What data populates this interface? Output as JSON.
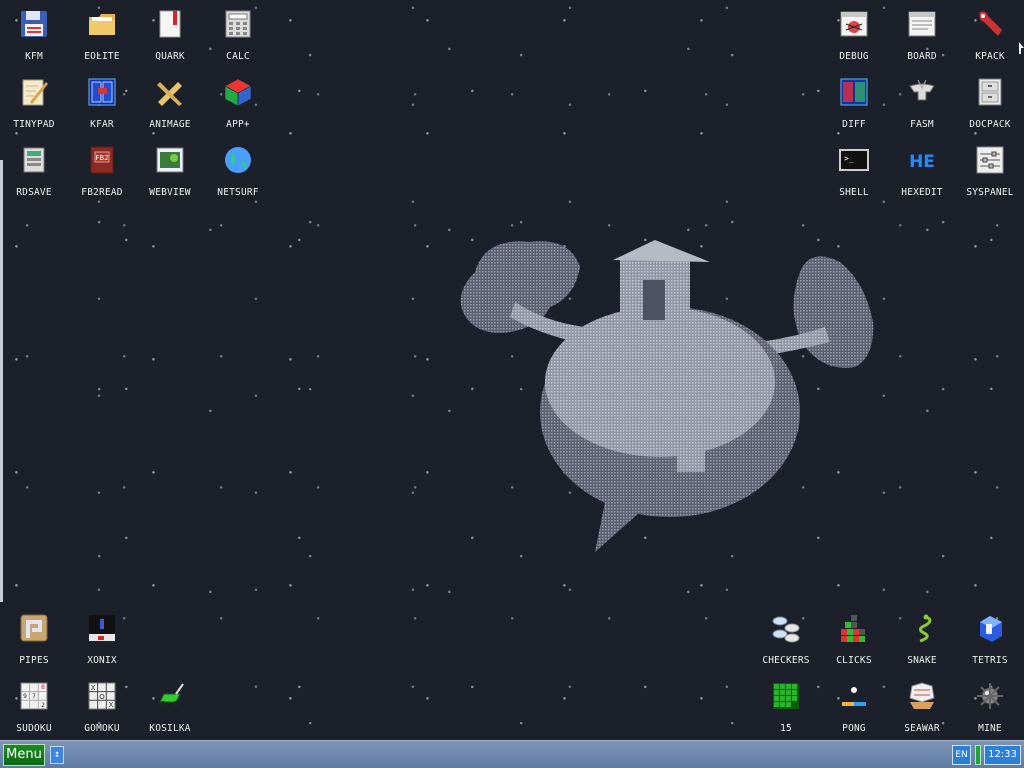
{
  "desktop": {
    "icons": [
      {
        "id": "kfm",
        "label": "KFM",
        "icon": "floppy-disk-icon"
      },
      {
        "id": "eolite",
        "label": "EOLITE",
        "icon": "folder-icon"
      },
      {
        "id": "quark",
        "label": "QUARK",
        "icon": "notebook-icon"
      },
      {
        "id": "calc",
        "label": "CALC",
        "icon": "calculator-icon"
      },
      {
        "id": "tinypad",
        "label": "TINYPAD",
        "icon": "notepad-icon"
      },
      {
        "id": "kfar",
        "label": "KFAR",
        "icon": "blue-panels-icon"
      },
      {
        "id": "animage",
        "label": "ANIMAGE",
        "icon": "pencil-ruler-icon"
      },
      {
        "id": "app-plus",
        "label": "APP+",
        "icon": "rubik-cube-icon"
      },
      {
        "id": "rdsave",
        "label": "RDSAVE",
        "icon": "ram-disk-save-icon"
      },
      {
        "id": "fb2read",
        "label": "FB2READ",
        "icon": "book-icon"
      },
      {
        "id": "webview",
        "label": "WEBVIEW",
        "icon": "web-page-icon"
      },
      {
        "id": "netsurf",
        "label": "NETSURF",
        "icon": "globe-icon"
      },
      {
        "id": "debug",
        "label": "DEBUG",
        "icon": "bug-window-icon"
      },
      {
        "id": "board",
        "label": "BOARD",
        "icon": "text-window-icon"
      },
      {
        "id": "kpack",
        "label": "KPACK",
        "icon": "wrench-icon"
      },
      {
        "id": "diff",
        "label": "DIFF",
        "icon": "compare-panels-icon"
      },
      {
        "id": "fasm",
        "label": "FASM",
        "icon": "anvil-icon"
      },
      {
        "id": "docpack",
        "label": "DOCPACK",
        "icon": "cabinet-icon"
      },
      {
        "id": "shell",
        "label": "SHELL",
        "icon": "terminal-icon"
      },
      {
        "id": "hexedit",
        "label": "HEXEDIT",
        "icon": "hex-letters-icon"
      },
      {
        "id": "syspanel",
        "label": "SYSPANEL",
        "icon": "sliders-icon"
      },
      {
        "id": "pipes",
        "label": "PIPES",
        "icon": "pipe-tile-icon"
      },
      {
        "id": "xonix",
        "label": "XONIX",
        "icon": "xonix-field-icon"
      },
      {
        "id": "sudoku",
        "label": "SUDOKU",
        "icon": "sudoku-grid-icon"
      },
      {
        "id": "gomoku",
        "label": "GOMOKU",
        "icon": "tic-tac-toe-icon"
      },
      {
        "id": "kosilka",
        "label": "KOSILKA",
        "icon": "lawn-mower-icon"
      },
      {
        "id": "checkers",
        "label": "CHECKERS",
        "icon": "checkers-pieces-icon"
      },
      {
        "id": "clicks",
        "label": "CLICKS",
        "icon": "color-blocks-icon"
      },
      {
        "id": "snake",
        "label": "SNAKE",
        "icon": "snake-icon"
      },
      {
        "id": "tetris",
        "label": "TETRIS",
        "icon": "tetris-block-icon"
      },
      {
        "id": "game-15",
        "label": "15",
        "icon": "puzzle-15-icon"
      },
      {
        "id": "pong",
        "label": "PONG",
        "icon": "paddle-ball-icon"
      },
      {
        "id": "seawar",
        "label": "SEAWAR",
        "icon": "ship-icon"
      },
      {
        "id": "mine",
        "label": "MINE",
        "icon": "mine-icon"
      }
    ]
  },
  "taskbar": {
    "menu_label": "Menu",
    "scroll_glyph": "↕",
    "language": "EN",
    "clock": "12:33"
  },
  "colors": {
    "desktop_bg": "#1b202b",
    "label": "#f0f0f0",
    "taskbar": "#6b86ae",
    "menu_button": "#138019",
    "clock_bg": "#2a7fd8"
  }
}
